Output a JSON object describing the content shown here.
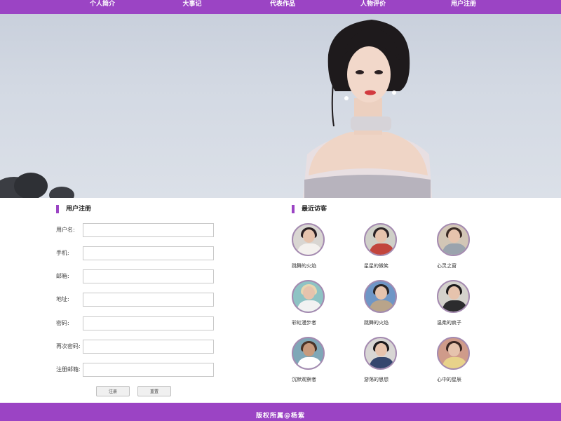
{
  "nav": {
    "items": [
      "个人简介",
      "大事记",
      "代表作品",
      "人物评价",
      "用户注册"
    ]
  },
  "register": {
    "title": "用户注册",
    "fields": [
      {
        "label": "用户名:",
        "value": ""
      },
      {
        "label": "手机:",
        "value": ""
      },
      {
        "label": "邮箱:",
        "value": ""
      },
      {
        "label": "地址:",
        "value": ""
      },
      {
        "label": "密码:",
        "value": ""
      },
      {
        "label": "再次密码:",
        "value": ""
      },
      {
        "label": "注册邮箱:",
        "value": ""
      }
    ],
    "submit_label": "注册",
    "reset_label": "重置"
  },
  "visitors": {
    "title": "最近访客",
    "items": [
      {
        "name": "跳舞的火焰"
      },
      {
        "name": "星星的微笑"
      },
      {
        "name": "心灵之窗"
      },
      {
        "name": "彩虹漫步者"
      },
      {
        "name": "跳舞的火焰"
      },
      {
        "name": "温柔的疯子"
      },
      {
        "name": "沉默观察者"
      },
      {
        "name": "游荡的思想"
      },
      {
        "name": "心中的星辰"
      }
    ]
  },
  "footer": {
    "text": "版权所属@杨紫"
  },
  "colors": {
    "accent": "#9b44c4",
    "footer_text": "#ffffff"
  },
  "icons": {
    "section_marker": "vertical-bar-icon",
    "avatar": "user-avatar-icon"
  }
}
